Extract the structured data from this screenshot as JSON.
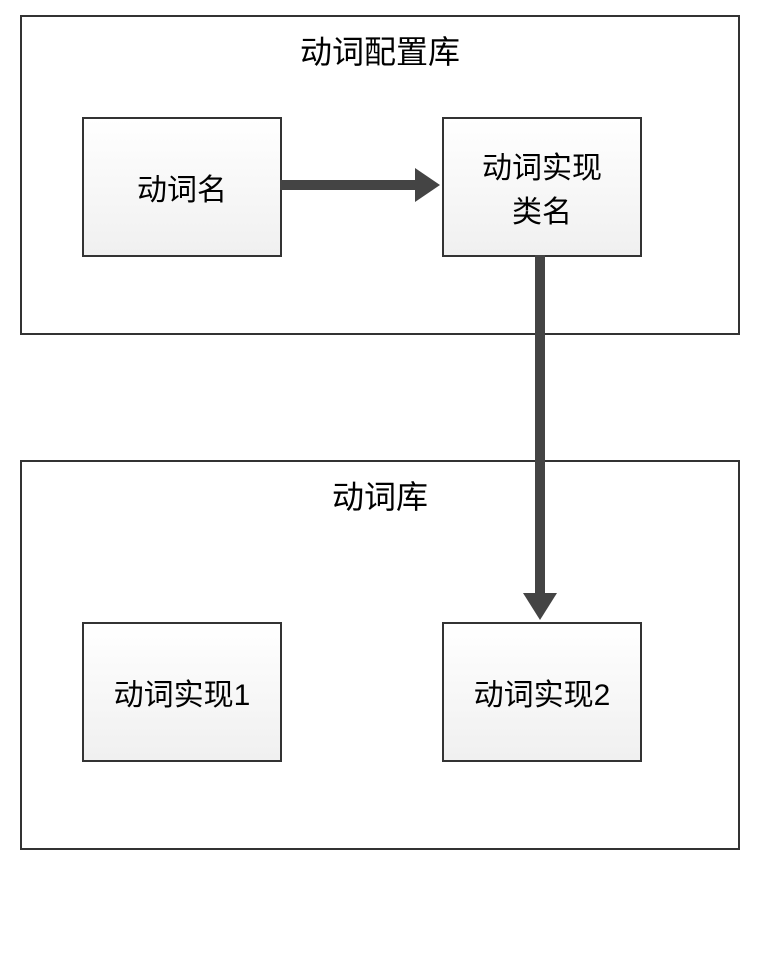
{
  "container1": {
    "title": "动词配置库",
    "box1": "动词名",
    "box2": "动词实现\n类名"
  },
  "container2": {
    "title": "动词库",
    "box1": "动词实现1",
    "box2": "动词实现2"
  }
}
